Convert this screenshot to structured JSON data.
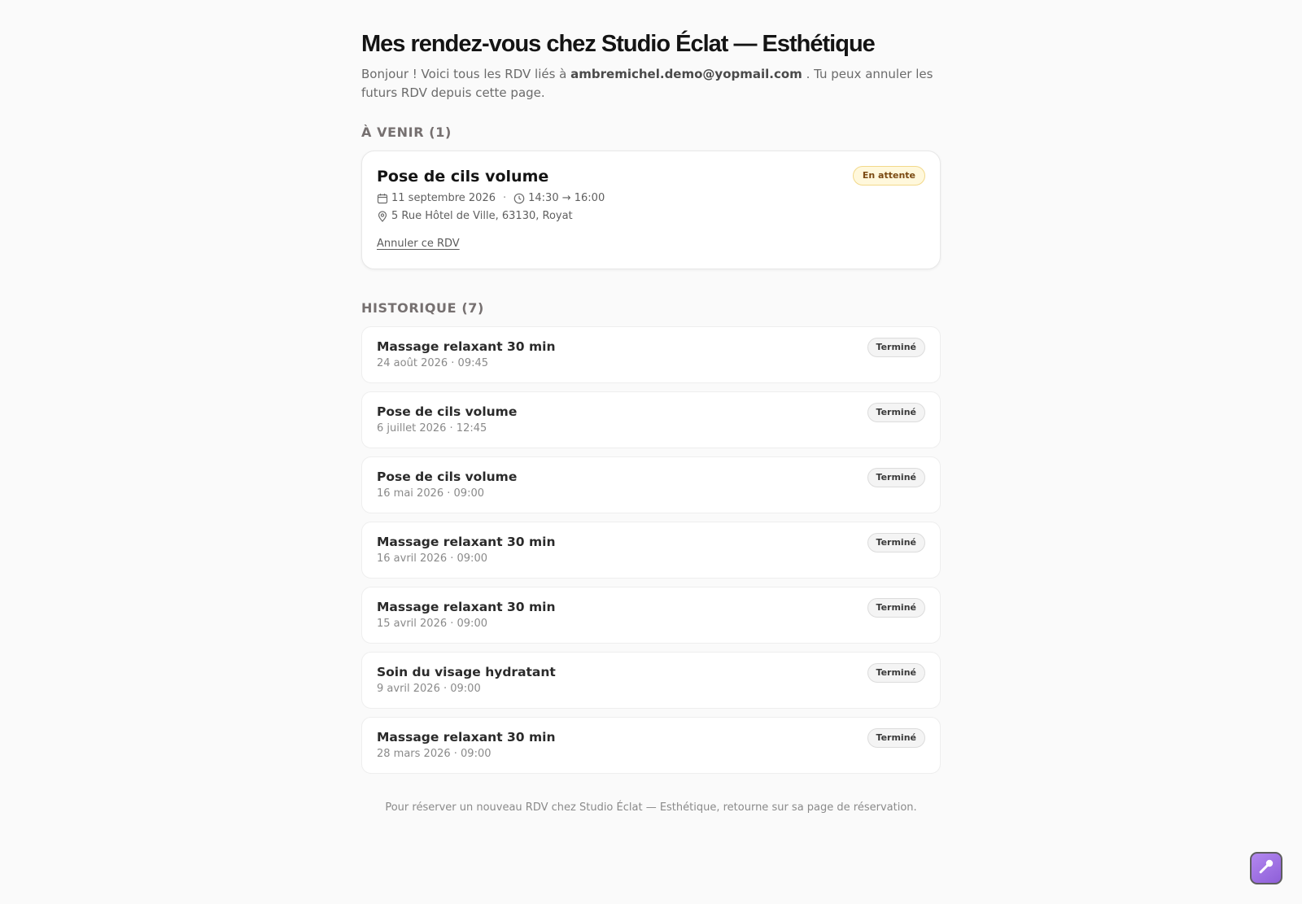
{
  "page": {
    "title": "Mes rendez-vous chez Studio Éclat — Esthétique",
    "intro_before": "Bonjour ! Voici tous les RDV liés à",
    "email": "ambremichel.demo@yopmail.com",
    "intro_after": ". Tu peux annuler les futurs RDV depuis cette page."
  },
  "upcoming": {
    "heading": "À VENIR (1)",
    "items": [
      {
        "service": "Pose de cils volume",
        "date": "11 septembre 2026",
        "time": "14:30 → 16:00",
        "address": "5 Rue Hôtel de Ville, 63130, Royat",
        "status": "En attente",
        "cancel_label": "Annuler ce RDV"
      }
    ]
  },
  "history": {
    "heading": "HISTORIQUE (7)",
    "items": [
      {
        "service": "Massage relaxant 30 min",
        "when": "24 août 2026 · 09:45",
        "status": "Terminé"
      },
      {
        "service": "Pose de cils volume",
        "when": "6 juillet 2026 · 12:45",
        "status": "Terminé"
      },
      {
        "service": "Pose de cils volume",
        "when": "16 mai 2026 · 09:00",
        "status": "Terminé"
      },
      {
        "service": "Massage relaxant 30 min",
        "when": "16 avril 2026 · 09:00",
        "status": "Terminé"
      },
      {
        "service": "Massage relaxant 30 min",
        "when": "15 avril 2026 · 09:00",
        "status": "Terminé"
      },
      {
        "service": "Soin du visage hydratant",
        "when": "9 avril 2026 · 09:00",
        "status": "Terminé"
      },
      {
        "service": "Massage relaxant 30 min",
        "when": "28 mars 2026 · 09:00",
        "status": "Terminé"
      }
    ]
  },
  "footer": {
    "note": "Pour réserver un nouveau RDV chez Studio Éclat — Esthétique, retourne sur sa page de réservation."
  },
  "icons": {
    "calendar": "calendar-icon",
    "clock": "clock-icon",
    "location": "map-pin-icon",
    "fab": "wand-icon"
  },
  "colors": {
    "background": "#fafafa",
    "pending_bg": "#fff8dc",
    "pending_border": "#f2d98a",
    "pending_text": "#7a4a12",
    "done_bg": "#f4f4f4",
    "fab_accent": "#a57ae8"
  }
}
